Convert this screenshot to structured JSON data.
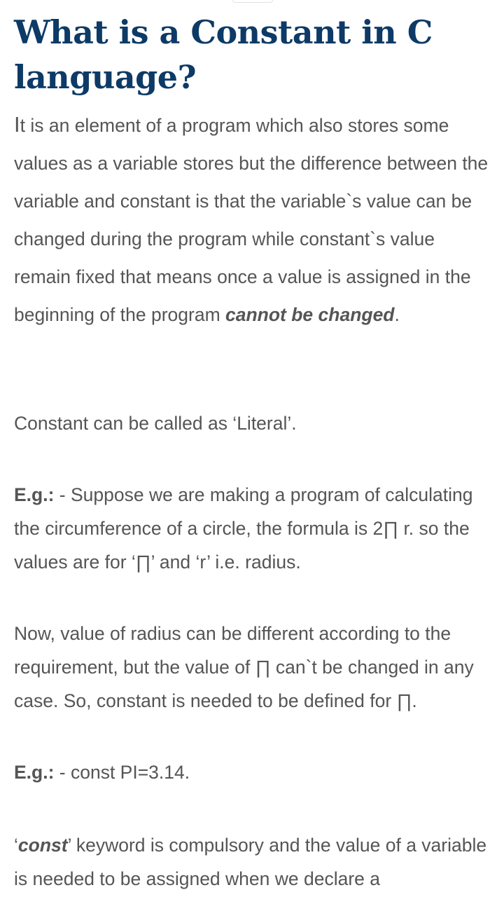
{
  "article": {
    "title": "What is a Constant in C language?",
    "para1": {
      "dropcap": "I",
      "text": "t is an element of a program which also stores some values as a variable stores but the difference between the variable and constant is that the variable`s value can be changed during the program while constant`s value remain fixed that means once a value is assigned in the beginning of the program ",
      "emphasis": "cannot be changed",
      "end": "."
    },
    "para2": "Constant can be called as ‘Literal’.",
    "para3": {
      "label": "E.g.:",
      "text": " - Suppose we are making a program of calculating the circumference of a circle, the formula is 2∏ r. so the values are for ‘∏’ and ‘r’ i.e. radius."
    },
    "para4": "Now, value of radius can be different according to the requirement, but the value of ∏ can`t be changed in any case. So, constant is needed to be defined for ∏.",
    "para5": {
      "label": "E.g.:",
      "text": " - const PI=3.14."
    },
    "para6": {
      "quote_open": "‘",
      "keyword": "const",
      "text": "’ keyword is compulsory and the value of a variable is needed to be assigned when we declare a"
    }
  }
}
